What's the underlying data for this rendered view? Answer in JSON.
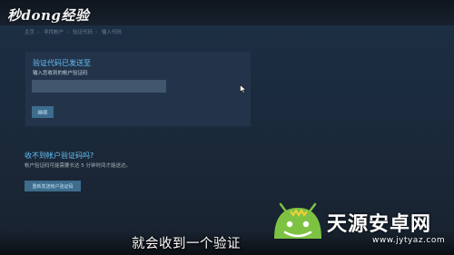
{
  "watermark": {
    "logo_text": "秒dong经验"
  },
  "breadcrumb": {
    "items": [
      "主页",
      "寻找帐户",
      "验证代码",
      "输入代码"
    ]
  },
  "verify_card": {
    "title": "验证代码已发送至",
    "label": "输入您收到的帐户验证码",
    "code_value": "",
    "continue_label": "继续"
  },
  "help": {
    "title": "收不到帐户验证码吗?",
    "description": "帐户验证码可能需要长达 5 分钟时间才能送达。",
    "resend_label": "重新发送帐户验证码"
  },
  "video": {
    "subtitle": "就会收到一个验证"
  },
  "brand_watermark": {
    "name": "天源安卓网",
    "url": "www.jytyaz.com"
  },
  "colors": {
    "accent": "#66c0f4",
    "page_bg": "#1b2838",
    "card_bg": "#23344a",
    "button": "#3d6c8d"
  }
}
